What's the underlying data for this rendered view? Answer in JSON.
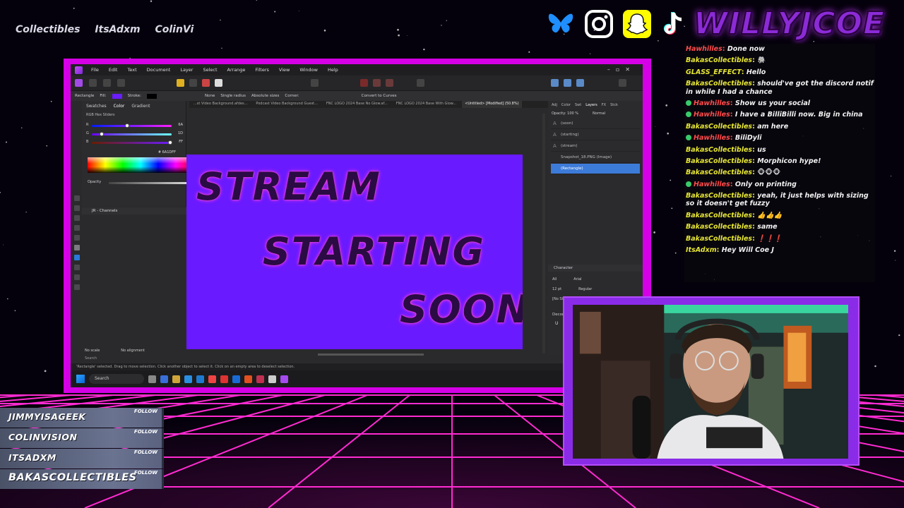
{
  "ticker": [
    "Collectibles",
    "ItsAdxm",
    "ColinVi"
  ],
  "socials": {
    "icons": [
      "bluesky-icon",
      "instagram-icon",
      "snapchat-icon",
      "tiktok-icon"
    ],
    "channel_name": "WILLYJCOE"
  },
  "app": {
    "menu": [
      "File",
      "Edit",
      "Text",
      "Document",
      "Layer",
      "Select",
      "Arrange",
      "Filters",
      "View",
      "Window",
      "Help"
    ],
    "context": {
      "tool": "Rectangle",
      "fill_label": "Fill:",
      "stroke_label": "Stroke:",
      "none": "None",
      "single_radius": "Single radius",
      "absolute_sizes": "Absolute sizes",
      "corner_label": "Corner:",
      "convert": "Convert to Curves"
    },
    "doc_tabs": [
      "...st Video Background.afdes...",
      "Podcast Video Background Guest...",
      "FNC LOGO 2024 Base No Glow.af...",
      "FNC LOGO 2024 Base With Glow...",
      "<Untitled> [Modified] (50.8%)"
    ],
    "color_panel": {
      "tabs": [
        "Swatches",
        "Color",
        "Gradient"
      ],
      "mode": "RGB Hex Sliders",
      "sliders": [
        {
          "label": "R",
          "value": "6A"
        },
        {
          "label": "G",
          "value": "1D"
        },
        {
          "label": "B",
          "value": "FF"
        }
      ],
      "hex": "# 6A1DFF",
      "opacity_label": "Opacity"
    },
    "channels_title": "JR - Channels",
    "align": {
      "scale": "No scale",
      "alignment": "No alignment"
    },
    "search_placeholder": "Search",
    "artboard_lines": [
      "STREAM",
      "STARTING",
      "SOON"
    ],
    "layers_panel": {
      "tabs": [
        "Adj",
        "Color",
        "Swt",
        "Layers",
        "FX",
        "Stck"
      ],
      "opacity": "Opacity: 100 %",
      "blend": "Normal",
      "layers": [
        "(soon)",
        "(starting)",
        "(stream)",
        "Snapshot_18.PNG (Image)",
        "(Rectangle)"
      ]
    },
    "character": {
      "title": "Character",
      "all": "All",
      "font": "Arial",
      "size": "12 pt",
      "weight": "Regular",
      "style": "[No Style]",
      "decorations": "Decorations"
    },
    "status": "'Rectangle' selected. Drag to move selection. Click another object to select it. Click on an empty area to deselect selection.",
    "taskbar_search": "Search"
  },
  "chat": [
    {
      "user": "Hawhilles",
      "text": "Done now",
      "color": "#ff4a4a",
      "badge": false
    },
    {
      "user": "BakasCollectibles",
      "text": "🐘",
      "color": "#e6e635",
      "badge": false
    },
    {
      "user": "GLASS_EFFECT",
      "text": "Hello",
      "color": "#e6e635",
      "badge": false
    },
    {
      "user": "BakasCollectibles",
      "text": "should've got the discord notif in while I had a chance",
      "color": "#e6e635",
      "badge": false
    },
    {
      "user": "Hawhilles",
      "text": "Show us your social",
      "color": "#ff4a4a",
      "badge": true
    },
    {
      "user": "Hawhilles",
      "text": "I have a BilliBilli now. Big in china",
      "color": "#ff4a4a",
      "badge": true
    },
    {
      "user": "BakasCollectibles",
      "text": "am here",
      "color": "#e6e635",
      "badge": false
    },
    {
      "user": "Hawhilles",
      "text": "BiliDyli",
      "color": "#ff4a4a",
      "badge": true
    },
    {
      "user": "BakasCollectibles",
      "text": "us",
      "color": "#e6e635",
      "badge": false
    },
    {
      "user": "BakasCollectibles",
      "text": "Morphicon hype!",
      "color": "#e6e635",
      "badge": false
    },
    {
      "user": "BakasCollectibles",
      "text": "🐵🐵🐵",
      "color": "#e6e635",
      "badge": false
    },
    {
      "user": "Hawhilles",
      "text": "Only on printing",
      "color": "#ff4a4a",
      "badge": true
    },
    {
      "user": "BakasCollectibles",
      "text": "yeah, it just helps with sizing so it doesn't get fuzzy",
      "color": "#e6e635",
      "badge": false
    },
    {
      "user": "BakasCollectibles",
      "text": "👍👍👍",
      "color": "#e6e635",
      "badge": false
    },
    {
      "user": "BakasCollectibles",
      "text": "same",
      "color": "#e6e635",
      "badge": false
    },
    {
      "user": "BakasCollectibles",
      "text": "❗❗❗",
      "color": "#e6e635",
      "badge": false
    },
    {
      "user": "ItsAdxm",
      "text": "Hey Will Coe J",
      "color": "#e6e635",
      "badge": false
    }
  ],
  "follows": [
    {
      "name": "JIMMYISAGEEK",
      "tag": "FOLLOW"
    },
    {
      "name": "COLINVISION",
      "tag": "FOLLOW"
    },
    {
      "name": "ITSADXM",
      "tag": "FOLLOW"
    },
    {
      "name": "BAKASCOLLECTIBLES",
      "tag": "FOLLOW"
    }
  ],
  "colors": {
    "accent_magenta": "#d500e6",
    "accent_purple": "#8a2be8",
    "artboard": "#6a1aff",
    "grid": "#ff2bd1"
  }
}
